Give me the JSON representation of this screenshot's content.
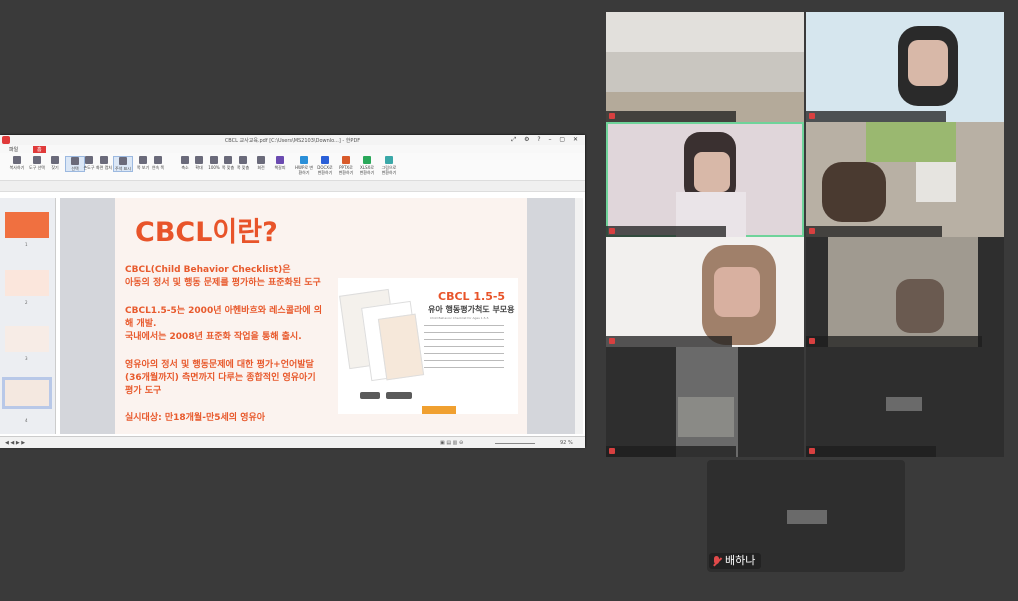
{
  "pdf_window": {
    "title": "CBCL 교사교육.pdf [C:\\Users\\MS2103\\Downlo...] - 한PDF",
    "menu": {
      "file": "파일",
      "home": "홈"
    },
    "tools": [
      "복사하기",
      "도구 선택",
      "찾기",
      "선택",
      "손도구",
      "화면 캡처",
      "주석 표시",
      "쪽 보기",
      "연속 쪽",
      "",
      "축소",
      "확대",
      "100%",
      "쪽 맞춤",
      "폭 맞춤",
      "회전",
      "책갈피",
      "HWP로 변환하기",
      "DOCX로 변환하기",
      "PPTX로 변환하기",
      "XLSX로 변환하기",
      "그림으로 변환하기"
    ],
    "thumbnail_numbers": [
      "1",
      "2",
      "3",
      "4"
    ],
    "zoom": "92 %",
    "slide": {
      "title": "CBCL이란?",
      "p1": "CBCL(Child Behavior Checklist)은\n아동의 정서 및 행동 문제를 평가하는 표준화된 도구",
      "p2": "CBCL1.5-5는 2000년 아헨바흐와 레스콜라에 의\n해 개발.\n국내에서는 2008년 표준화 작업을 통해 출시.",
      "p3": "영유아의 정서 및 행동문제에 대한 평가+언어발달\n(36개월까지) 측면까지 다루는 종합적인 영유아기\n평가 도구",
      "p4": "실시대상: 만18개월-만5세의 영유아",
      "book": {
        "title": "CBCL 1.5-5",
        "subtitle": "유아 행동평가척도 부모용",
        "en": "Child Behavior Checklist for Ages 1.5-5"
      }
    }
  },
  "participants": {
    "bottom_label": "배하나"
  },
  "colors": {
    "accent": "#e8542a",
    "active_speaker": "#6fd39a"
  }
}
